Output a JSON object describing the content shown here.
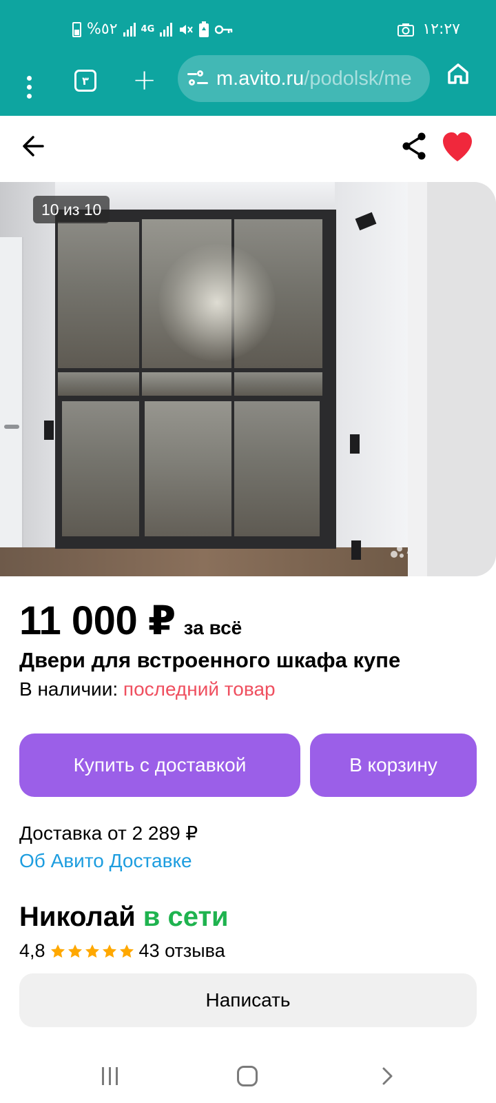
{
  "status_bar": {
    "battery_text": "%٥٢",
    "network_label": "4G",
    "time": "١٢:٢٧"
  },
  "browser": {
    "tab_count": "٣",
    "url_host": "m.avito.ru",
    "url_path": "/podolsk/me"
  },
  "gallery": {
    "counter": "10 из 10",
    "watermark": "Av"
  },
  "item": {
    "price": "11 000 ₽",
    "price_suffix": "за всё",
    "title": "Двери для встроенного шкафа купе",
    "stock_label": "В наличии:",
    "stock_status": "последний товар"
  },
  "actions": {
    "buy_label": "Купить с доставкой",
    "cart_label": "В корзину"
  },
  "delivery": {
    "text": "Доставка от 2 289 ₽",
    "link": "Об Авито Доставке"
  },
  "seller": {
    "name": "Николай",
    "online": "в сети",
    "rating": "4,8",
    "stars": 5,
    "reviews": "43 отзыва",
    "write_label": "Написать"
  },
  "colors": {
    "browser_bar": "#0ea5a0",
    "accent_purple": "#9b5fe8",
    "link_blue": "#1d9ddf",
    "online_green": "#1fb34f",
    "stock_red": "#ef4f5f",
    "favorite_red": "#f0283c",
    "star_orange": "#ffa800"
  },
  "icons": {
    "header_back": "arrow-left-icon",
    "header_share": "share-icon",
    "header_favorite": "heart-filled-icon",
    "browser_home": "home-icon",
    "browser_menu": "kebab-menu-icon",
    "browser_new_tab": "plus-icon"
  }
}
